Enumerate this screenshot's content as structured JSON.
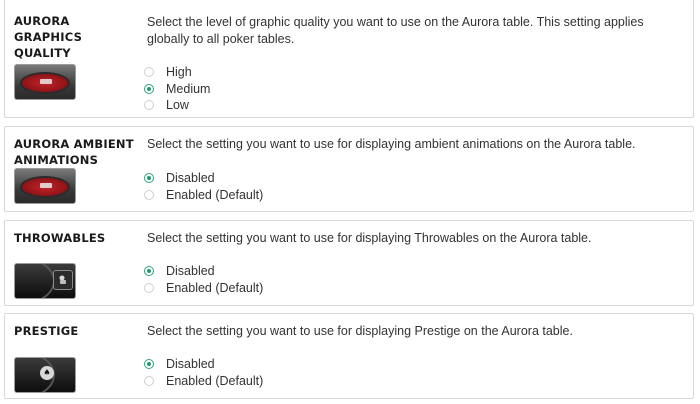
{
  "sections": [
    {
      "title": "AURORA\nGRAPHICS\nQUALITY",
      "description": "Select the level of graphic quality you want to use on the Aurora table. This setting applies globally to all poker tables.",
      "thumbnail_icon": "poker-table-icon",
      "options": [
        {
          "label": "High",
          "checked": false
        },
        {
          "label": "Medium",
          "checked": true
        },
        {
          "label": "Low",
          "checked": false
        }
      ]
    },
    {
      "title": "AURORA AMBIENT\nANIMATIONS",
      "description": "Select the setting you want to use for displaying ambient animations on the Aurora table.",
      "thumbnail_icon": "poker-table-icon",
      "options": [
        {
          "label": "Disabled",
          "checked": true
        },
        {
          "label": "Enabled (Default)",
          "checked": false
        }
      ]
    },
    {
      "title": "THROWABLES",
      "description": "Select the setting you want to use for displaying Throwables on the Aurora table.",
      "thumbnail_icon": "throwables-icon",
      "options": [
        {
          "label": "Disabled",
          "checked": true
        },
        {
          "label": "Enabled (Default)",
          "checked": false
        }
      ]
    },
    {
      "title": "PRESTIGE",
      "description": "Select the setting you want to use for displaying Prestige on the Aurora table.",
      "thumbnail_icon": "prestige-icon",
      "options": [
        {
          "label": "Disabled",
          "checked": true
        },
        {
          "label": "Enabled (Default)",
          "checked": false
        }
      ]
    }
  ],
  "colors": {
    "accent": "#1f9a74",
    "border": "#d8d8d8",
    "title": "#1a1a1a",
    "text": "#333333"
  }
}
